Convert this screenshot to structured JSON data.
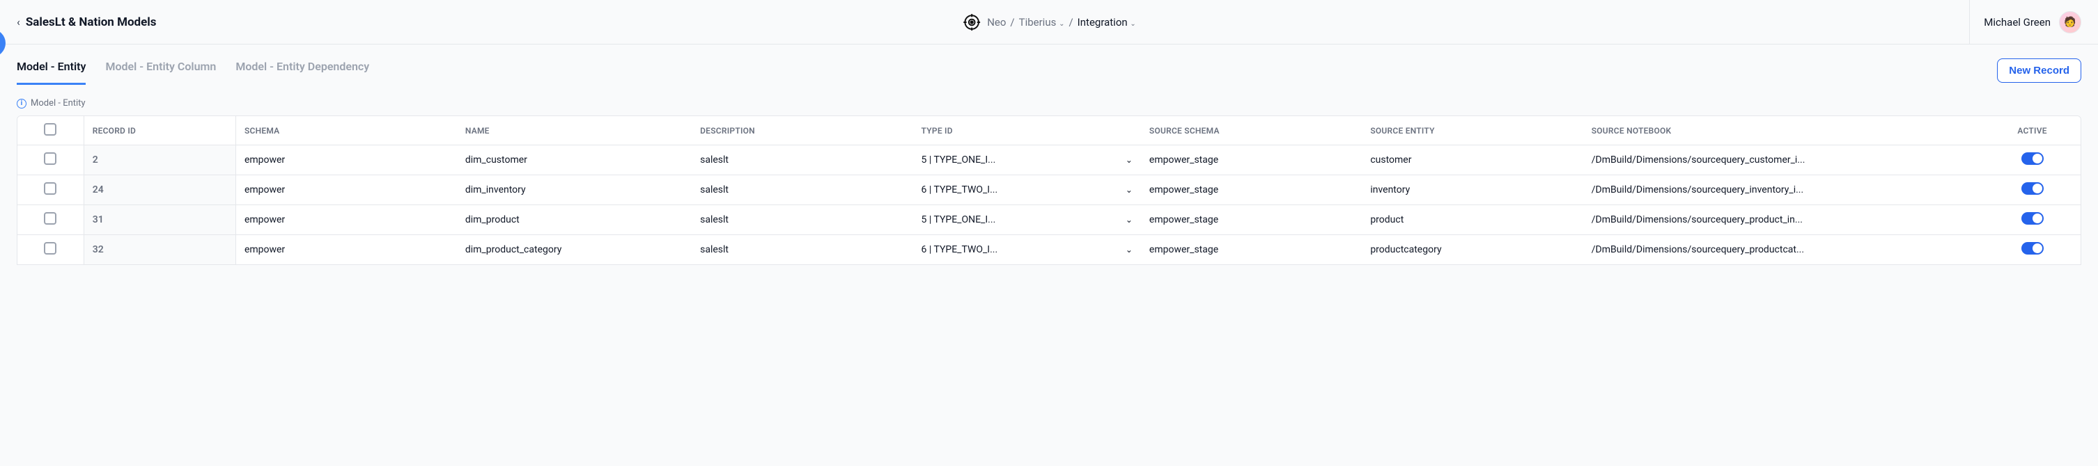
{
  "header": {
    "page_title": "SalesLt & Nation Models",
    "breadcrumb": {
      "part1": "Neo",
      "sep": "/",
      "part2": "Tiberius",
      "part3": "Integration"
    },
    "user_name": "Michael Green"
  },
  "tabs": [
    {
      "label": "Model - Entity",
      "active": true
    },
    {
      "label": "Model - Entity Column",
      "active": false
    },
    {
      "label": "Model - Entity Dependency",
      "active": false
    }
  ],
  "new_record_label": "New Record",
  "section_label": "Model - Entity",
  "table": {
    "headers": {
      "record_id": "RECORD ID",
      "schema": "SCHEMA",
      "name": "NAME",
      "description": "DESCRIPTION",
      "type_id": "TYPE ID",
      "source_schema": "SOURCE SCHEMA",
      "source_entity": "SOURCE ENTITY",
      "source_notebook": "SOURCE NOTEBOOK",
      "active": "ACTIVE"
    },
    "rows": [
      {
        "record_id": "2",
        "schema": "empower",
        "name": "dim_customer",
        "description": "saleslt",
        "type_id": "5 | TYPE_ONE_I...",
        "source_schema": "empower_stage",
        "source_entity": "customer",
        "source_notebook": "/DmBuild/Dimensions/sourcequery_customer_i...",
        "active": true
      },
      {
        "record_id": "24",
        "schema": "empower",
        "name": "dim_inventory",
        "description": "saleslt",
        "type_id": "6 | TYPE_TWO_I...",
        "source_schema": "empower_stage",
        "source_entity": "inventory",
        "source_notebook": "/DmBuild/Dimensions/sourcequery_inventory_i...",
        "active": true
      },
      {
        "record_id": "31",
        "schema": "empower",
        "name": "dim_product",
        "description": "saleslt",
        "type_id": "5 | TYPE_ONE_I...",
        "source_schema": "empower_stage",
        "source_entity": "product",
        "source_notebook": "/DmBuild/Dimensions/sourcequery_product_in...",
        "active": true
      },
      {
        "record_id": "32",
        "schema": "empower",
        "name": "dim_product_category",
        "description": "saleslt",
        "type_id": "6 | TYPE_TWO_I...",
        "source_schema": "empower_stage",
        "source_entity": "productcategory",
        "source_notebook": "/DmBuild/Dimensions/sourcequery_productcat...",
        "active": true
      }
    ]
  }
}
